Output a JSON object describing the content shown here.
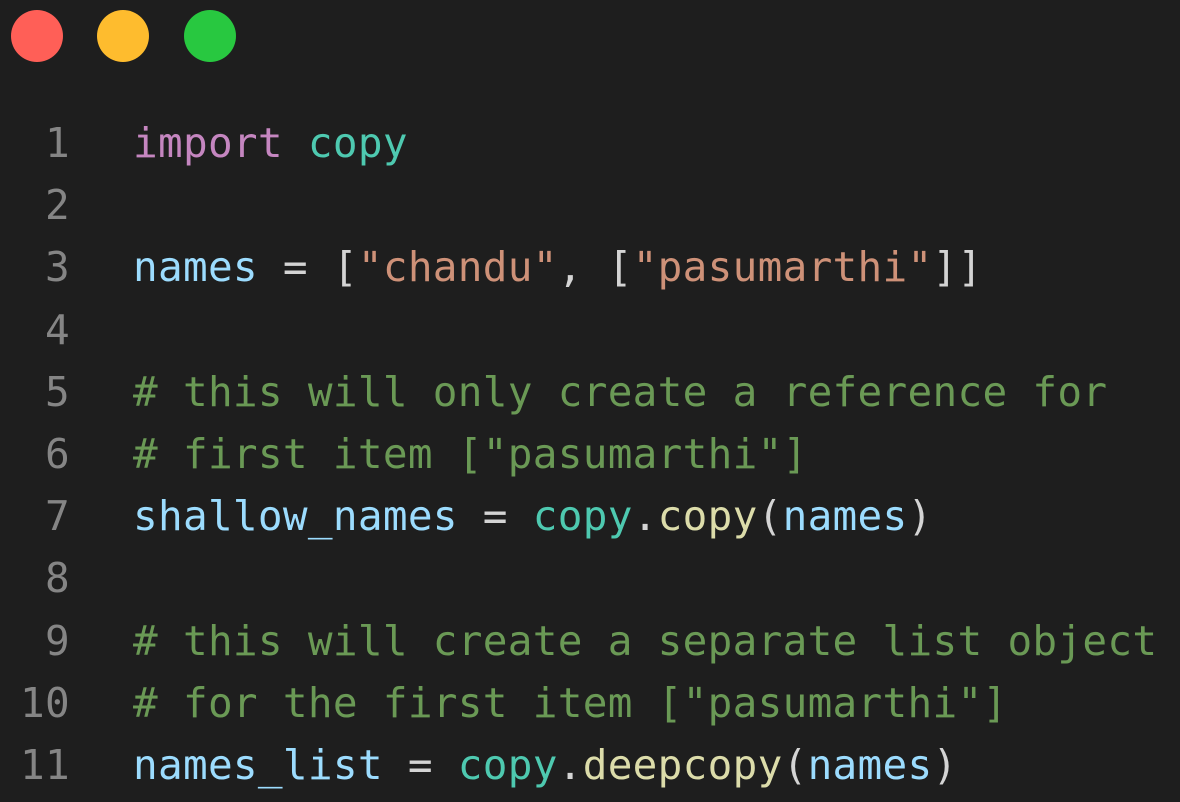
{
  "window": {
    "traffic_lights": [
      {
        "name": "close",
        "color": "#ff5f57"
      },
      {
        "name": "minimize",
        "color": "#febc2e"
      },
      {
        "name": "maximize",
        "color": "#28c840"
      }
    ]
  },
  "colors": {
    "background": "#1e1e1e",
    "line_number": "#858585",
    "keyword": "#c586c0",
    "module": "#4ec9b0",
    "variable": "#9cdcfe",
    "string": "#ce9178",
    "comment": "#6a9955",
    "function": "#dcdcaa",
    "punctuation": "#d4d4d4"
  },
  "editor": {
    "language": "python",
    "lines": [
      {
        "number": "1",
        "tokens": [
          {
            "text": "import",
            "type": "keyword"
          },
          {
            "text": " ",
            "type": "punctuation"
          },
          {
            "text": "copy",
            "type": "module"
          }
        ]
      },
      {
        "number": "2",
        "tokens": []
      },
      {
        "number": "3",
        "tokens": [
          {
            "text": "names",
            "type": "variable"
          },
          {
            "text": " = [",
            "type": "punctuation"
          },
          {
            "text": "\"chandu\"",
            "type": "string"
          },
          {
            "text": ", [",
            "type": "punctuation"
          },
          {
            "text": "\"pasumarthi\"",
            "type": "string"
          },
          {
            "text": "]]",
            "type": "punctuation"
          }
        ]
      },
      {
        "number": "4",
        "tokens": []
      },
      {
        "number": "5",
        "tokens": [
          {
            "text": "# this will only create a reference for",
            "type": "comment"
          }
        ]
      },
      {
        "number": "6",
        "tokens": [
          {
            "text": "# first item [\"pasumarthi\"]",
            "type": "comment"
          }
        ]
      },
      {
        "number": "7",
        "tokens": [
          {
            "text": "shallow_names",
            "type": "variable"
          },
          {
            "text": " = ",
            "type": "punctuation"
          },
          {
            "text": "copy",
            "type": "module"
          },
          {
            "text": ".",
            "type": "punctuation"
          },
          {
            "text": "copy",
            "type": "function"
          },
          {
            "text": "(",
            "type": "punctuation"
          },
          {
            "text": "names",
            "type": "variable"
          },
          {
            "text": ")",
            "type": "punctuation"
          }
        ]
      },
      {
        "number": "8",
        "tokens": []
      },
      {
        "number": "9",
        "tokens": [
          {
            "text": "# this will create a separate list object",
            "type": "comment"
          }
        ]
      },
      {
        "number": "10",
        "tokens": [
          {
            "text": "# for the first item [\"pasumarthi\"]",
            "type": "comment"
          }
        ]
      },
      {
        "number": "11",
        "tokens": [
          {
            "text": "names_list",
            "type": "variable"
          },
          {
            "text": " = ",
            "type": "punctuation"
          },
          {
            "text": "copy",
            "type": "module"
          },
          {
            "text": ".",
            "type": "punctuation"
          },
          {
            "text": "deepcopy",
            "type": "function"
          },
          {
            "text": "(",
            "type": "punctuation"
          },
          {
            "text": "names",
            "type": "variable"
          },
          {
            "text": ")",
            "type": "punctuation"
          }
        ]
      }
    ]
  }
}
